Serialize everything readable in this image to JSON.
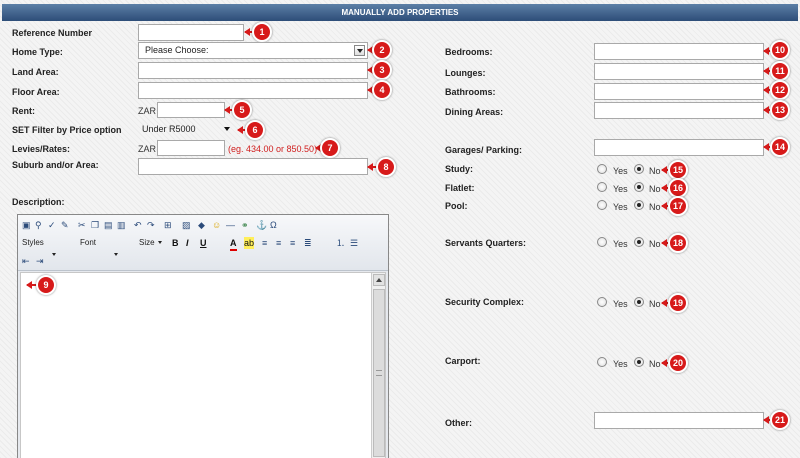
{
  "header": {
    "title": "MANUALLY ADD PROPERTIES"
  },
  "left": {
    "reference_label": "Reference Number",
    "home_type_label": "Home Type:",
    "home_type_value": "Please Choose:",
    "land_area_label": "Land Area:",
    "floor_area_label": "Floor Area:",
    "rent_label": "Rent:",
    "currency": "ZAR",
    "price_filter_label": "SET Filter by Price option",
    "price_filter_value": "Under R5000",
    "levies_label": "Levies/Rates:",
    "levies_hint": "(eg. 434.00 or 850.50)",
    "suburb_label": "Suburb and/or Area:",
    "description_label": "Description:"
  },
  "editor": {
    "styles_label": "Styles",
    "font_label": "Font",
    "size_label": "Size"
  },
  "right": {
    "bedrooms_label": "Bedrooms:",
    "lounges_label": "Lounges:",
    "bathrooms_label": "Bathrooms:",
    "dining_label": "Dining Areas:",
    "garages_label": "Garages/ Parking:",
    "study_label": "Study:",
    "flatlet_label": "Flatlet:",
    "pool_label": "Pool:",
    "servants_label": "Servants Quarters:",
    "security_label": "Security Complex:",
    "carport_label": "Carport:",
    "other_label": "Other:",
    "yes_label": "Yes",
    "no_label": "No"
  },
  "badges": [
    "1",
    "2",
    "3",
    "4",
    "5",
    "6",
    "7",
    "8",
    "9",
    "10",
    "11",
    "12",
    "13",
    "14",
    "15",
    "16",
    "17",
    "18",
    "19",
    "20",
    "21"
  ],
  "colors": {
    "header": "#2d4d78",
    "badge": "#d71a1a",
    "hint": "#d12020"
  }
}
